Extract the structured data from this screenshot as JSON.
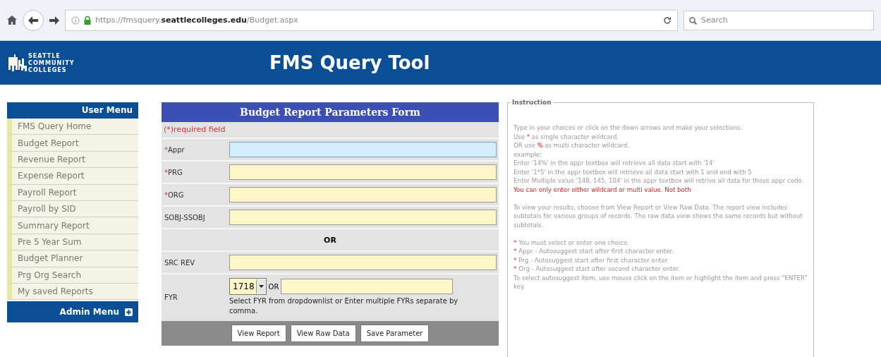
{
  "browser": {
    "url_prefix": "https://fmsquery.",
    "url_domain": "seattlecolleges.edu",
    "url_path": "/Budget.aspx",
    "search_placeholder": "Search"
  },
  "header": {
    "logo_lines": [
      "SEATTLE",
      "COMMUNITY",
      "COLLEGES"
    ],
    "title": "FMS Query Tool"
  },
  "user_menu": {
    "title": "User Menu",
    "items": [
      {
        "label": "FMS Query Home"
      },
      {
        "label": "Budget Report"
      },
      {
        "label": "Revenue Report"
      },
      {
        "label": "Expense Report"
      },
      {
        "label": "Payroll Report"
      },
      {
        "label": "Payroll by SID"
      },
      {
        "label": "Summary Report"
      },
      {
        "label": "Pre 5 Year Sum"
      },
      {
        "label": "Budget Planner"
      },
      {
        "label": "Prg Org Search"
      },
      {
        "label": "My saved Reports"
      }
    ],
    "admin_menu": "Admin Menu"
  },
  "form": {
    "title": "Budget Report Parameters Form",
    "required_note": "(*)required field",
    "rows": [
      {
        "kind": "field",
        "label": "Appr",
        "required": true,
        "focused": true
      },
      {
        "kind": "field",
        "label": "PRG",
        "required": true,
        "focused": false
      },
      {
        "kind": "field",
        "label": "ORG",
        "required": true,
        "focused": false
      },
      {
        "kind": "field",
        "label": "SOBJ-SSOBJ",
        "required": false,
        "focused": false
      },
      {
        "kind": "divider",
        "label": "OR"
      },
      {
        "kind": "field",
        "label": "SRC REV",
        "required": false,
        "focused": false
      },
      {
        "kind": "fyr",
        "label": "FYR",
        "select_value": "1718",
        "or": "OR",
        "help": "Select FYR from dropdownlist or Enter multiple FYRs separate by comma."
      }
    ],
    "required_mark": "*",
    "buttons": [
      "View Report",
      "View Raw Data",
      "Save Parameter"
    ]
  },
  "instruction": {
    "legend": "Instruction",
    "lines": [
      {
        "kind": "text",
        "segments": [
          {
            "text": "Type in your choices or click on the down arrows and make your selections.",
            "red": false
          }
        ]
      },
      {
        "kind": "text",
        "segments": [
          {
            "text": "Use ",
            "red": false
          },
          {
            "text": "*",
            "red": true
          },
          {
            "text": " as single character wildcard.",
            "red": false
          }
        ]
      },
      {
        "kind": "text",
        "segments": [
          {
            "text": "OR use ",
            "red": false
          },
          {
            "text": "%",
            "red": true
          },
          {
            "text": " as multi character wildcard.",
            "red": false
          }
        ]
      },
      {
        "kind": "text",
        "segments": [
          {
            "text": "example:",
            "red": false
          }
        ]
      },
      {
        "kind": "text",
        "segments": [
          {
            "text": "Enter '14%' in the appr textbox will retrieve all data start with '14'",
            "red": false
          }
        ]
      },
      {
        "kind": "text",
        "segments": [
          {
            "text": "Enter '1*5' in the appr textbox will retrieve all data start with 1 and end with 5",
            "red": false
          }
        ]
      },
      {
        "kind": "text",
        "segments": [
          {
            "text": "Enter Multiple value '148, 145, 104' in the appr textbox will retrive all data for those appr code. ",
            "red": false
          },
          {
            "text": "You can only enter either wildcard or multi value. Not both",
            "red": true
          }
        ]
      },
      {
        "kind": "gap"
      },
      {
        "kind": "text",
        "segments": [
          {
            "text": "To view your results, choose from View Report or View Raw Data. The report view includes subtotals for various groups of records. The raw data view shows the same records but without subtotals.",
            "red": false
          }
        ]
      },
      {
        "kind": "gap"
      },
      {
        "kind": "bullet",
        "marker": "*",
        "segments": [
          {
            "text": "You must select or enter one choice.",
            "red": false
          }
        ]
      },
      {
        "kind": "bullet",
        "marker": "*",
        "segments": [
          {
            "text": "Appr - Autosuggest start after first character enter.",
            "red": false
          }
        ]
      },
      {
        "kind": "bullet",
        "marker": "*",
        "segments": [
          {
            "text": "Prg - Autosuggest start after first character enter.",
            "red": false
          }
        ]
      },
      {
        "kind": "bullet",
        "marker": "*",
        "segments": [
          {
            "text": "Org - Autosuggest start after second character enter.",
            "red": false
          }
        ]
      },
      {
        "kind": "text",
        "segments": [
          {
            "text": "To select autosuggest item, use mouse click on the item or highlight the item and press \"ENTER\" key.",
            "red": false
          }
        ]
      }
    ]
  }
}
